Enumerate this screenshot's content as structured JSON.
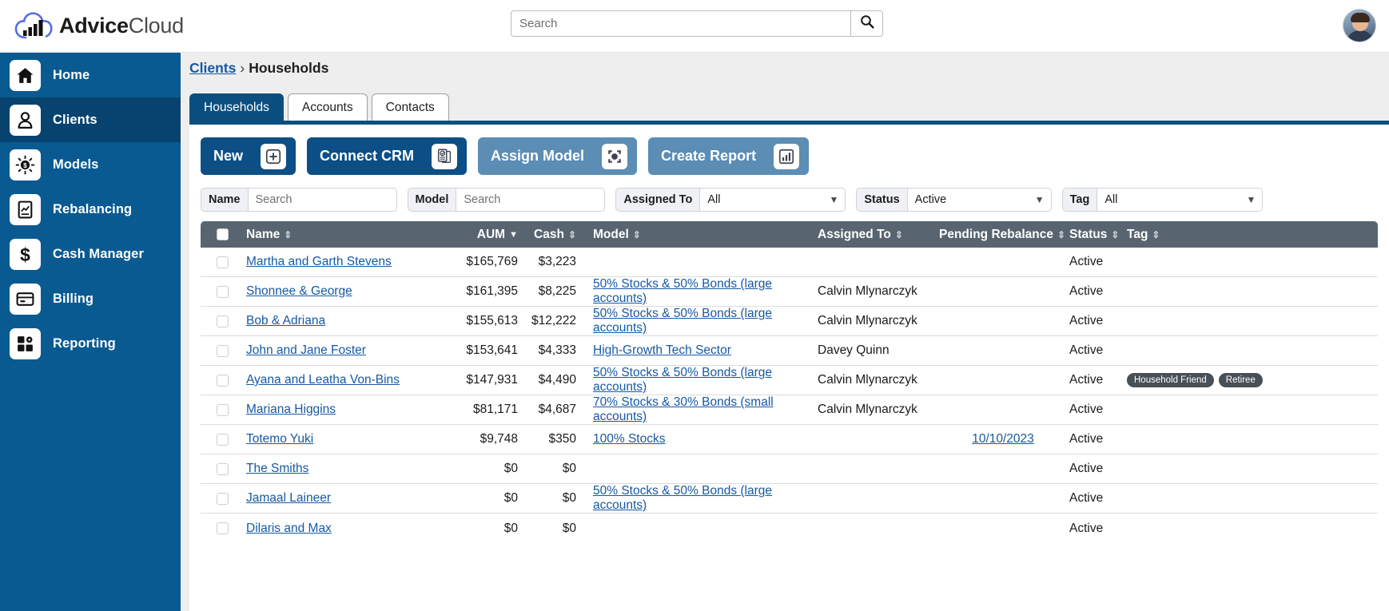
{
  "app": {
    "brand_bold": "Advice",
    "brand_light": "Cloud",
    "logo_icon": "cloud-bar-chart-logo"
  },
  "search": {
    "placeholder": "Search",
    "value": "",
    "button_icon": "search-icon"
  },
  "account": {
    "avatar_icon": "user-avatar"
  },
  "sidebar": {
    "items": [
      {
        "label": "Home",
        "icon": "home-icon",
        "active": false
      },
      {
        "label": "Clients",
        "icon": "person-icon",
        "active": true
      },
      {
        "label": "Models",
        "icon": "dollar-sun-icon",
        "active": false
      },
      {
        "label": "Rebalancing",
        "icon": "document-chart-icon",
        "active": false
      },
      {
        "label": "Cash Manager",
        "icon": "dollar-sign-icon",
        "active": false
      },
      {
        "label": "Billing",
        "icon": "credit-card-icon",
        "active": false
      },
      {
        "label": "Reporting",
        "icon": "dashboard-gear-icon",
        "active": false
      }
    ]
  },
  "breadcrumb": {
    "root": "Clients",
    "separator": "›",
    "current": "Households"
  },
  "tabs": [
    {
      "label": "Households",
      "active": true
    },
    {
      "label": "Accounts",
      "active": false
    },
    {
      "label": "Contacts",
      "active": false
    }
  ],
  "actions": [
    {
      "label": "New",
      "icon": "plus-square-icon",
      "style": "primary"
    },
    {
      "label": "Connect CRM",
      "icon": "document-check-icon",
      "style": "primary"
    },
    {
      "label": "Assign Model",
      "icon": "target-icon",
      "style": "muted"
    },
    {
      "label": "Create Report",
      "icon": "bar-chart-icon",
      "style": "muted"
    }
  ],
  "filters": {
    "name": {
      "label": "Name",
      "placeholder": "Search",
      "value": ""
    },
    "model": {
      "label": "Model",
      "placeholder": "Search",
      "value": ""
    },
    "assigned_to": {
      "label": "Assigned To",
      "value": "All"
    },
    "status": {
      "label": "Status",
      "value": "Active"
    },
    "tag": {
      "label": "Tag",
      "value": "All"
    }
  },
  "table": {
    "columns": [
      {
        "key": "name",
        "label": "Name",
        "sort": "both"
      },
      {
        "key": "aum",
        "label": "AUM",
        "sort": "desc"
      },
      {
        "key": "cash",
        "label": "Cash",
        "sort": "both"
      },
      {
        "key": "model",
        "label": "Model",
        "sort": "both"
      },
      {
        "key": "assigned_to",
        "label": "Assigned To",
        "sort": "both"
      },
      {
        "key": "pending_rebalance",
        "label": "Pending Rebalance",
        "sort": "both"
      },
      {
        "key": "status",
        "label": "Status",
        "sort": "both"
      },
      {
        "key": "tag",
        "label": "Tag",
        "sort": "both"
      }
    ],
    "sort_glyph_both": "⇕",
    "sort_glyph_desc": "▼",
    "rows": [
      {
        "name": "Martha and Garth Stevens",
        "aum": "$165,769",
        "cash": "$3,223",
        "model": "",
        "assigned_to": "",
        "pending_rebalance": "",
        "status": "Active",
        "tags": []
      },
      {
        "name": "Shonnee & George",
        "aum": "$161,395",
        "cash": "$8,225",
        "model": "50% Stocks & 50% Bonds (large accounts)",
        "assigned_to": "Calvin Mlynarczyk",
        "pending_rebalance": "",
        "status": "Active",
        "tags": []
      },
      {
        "name": "Bob & Adriana",
        "aum": "$155,613",
        "cash": "$12,222",
        "model": "50% Stocks & 50% Bonds (large accounts)",
        "assigned_to": "Calvin Mlynarczyk",
        "pending_rebalance": "",
        "status": "Active",
        "tags": []
      },
      {
        "name": "John and Jane Foster",
        "aum": "$153,641",
        "cash": "$4,333",
        "model": "High-Growth Tech Sector",
        "assigned_to": "Davey Quinn",
        "pending_rebalance": "",
        "status": "Active",
        "tags": []
      },
      {
        "name": "Ayana and Leatha Von-Bins",
        "aum": "$147,931",
        "cash": "$4,490",
        "model": "50% Stocks & 50% Bonds (large accounts)",
        "assigned_to": "Calvin Mlynarczyk",
        "pending_rebalance": "",
        "status": "Active",
        "tags": [
          "Household Friend",
          "Retiree"
        ]
      },
      {
        "name": "Mariana Higgins",
        "aum": "$81,171",
        "cash": "$4,687",
        "model": "70% Stocks & 30% Bonds (small accounts)",
        "assigned_to": "Calvin Mlynarczyk",
        "pending_rebalance": "",
        "status": "Active",
        "tags": []
      },
      {
        "name": "Totemo Yuki",
        "aum": "$9,748",
        "cash": "$350",
        "model": "100% Stocks",
        "assigned_to": "",
        "pending_rebalance": "10/10/2023",
        "status": "Active",
        "tags": []
      },
      {
        "name": "The Smiths",
        "aum": "$0",
        "cash": "$0",
        "model": "",
        "assigned_to": "",
        "pending_rebalance": "",
        "status": "Active",
        "tags": []
      },
      {
        "name": "Jamaal Laineer",
        "aum": "$0",
        "cash": "$0",
        "model": "50% Stocks & 50% Bonds (large accounts)",
        "assigned_to": "",
        "pending_rebalance": "",
        "status": "Active",
        "tags": []
      },
      {
        "name": "Dilaris and Max",
        "aum": "$0",
        "cash": "$0",
        "model": "",
        "assigned_to": "",
        "pending_rebalance": "",
        "status": "Active",
        "tags": []
      }
    ]
  },
  "colors": {
    "sidebar": "#0a5a92",
    "sidebar_active": "#07436e",
    "primary": "#0b4f86",
    "muted": "#5b8db5",
    "table_header": "#586570",
    "link": "#1559a5",
    "badge": "#474f57"
  }
}
